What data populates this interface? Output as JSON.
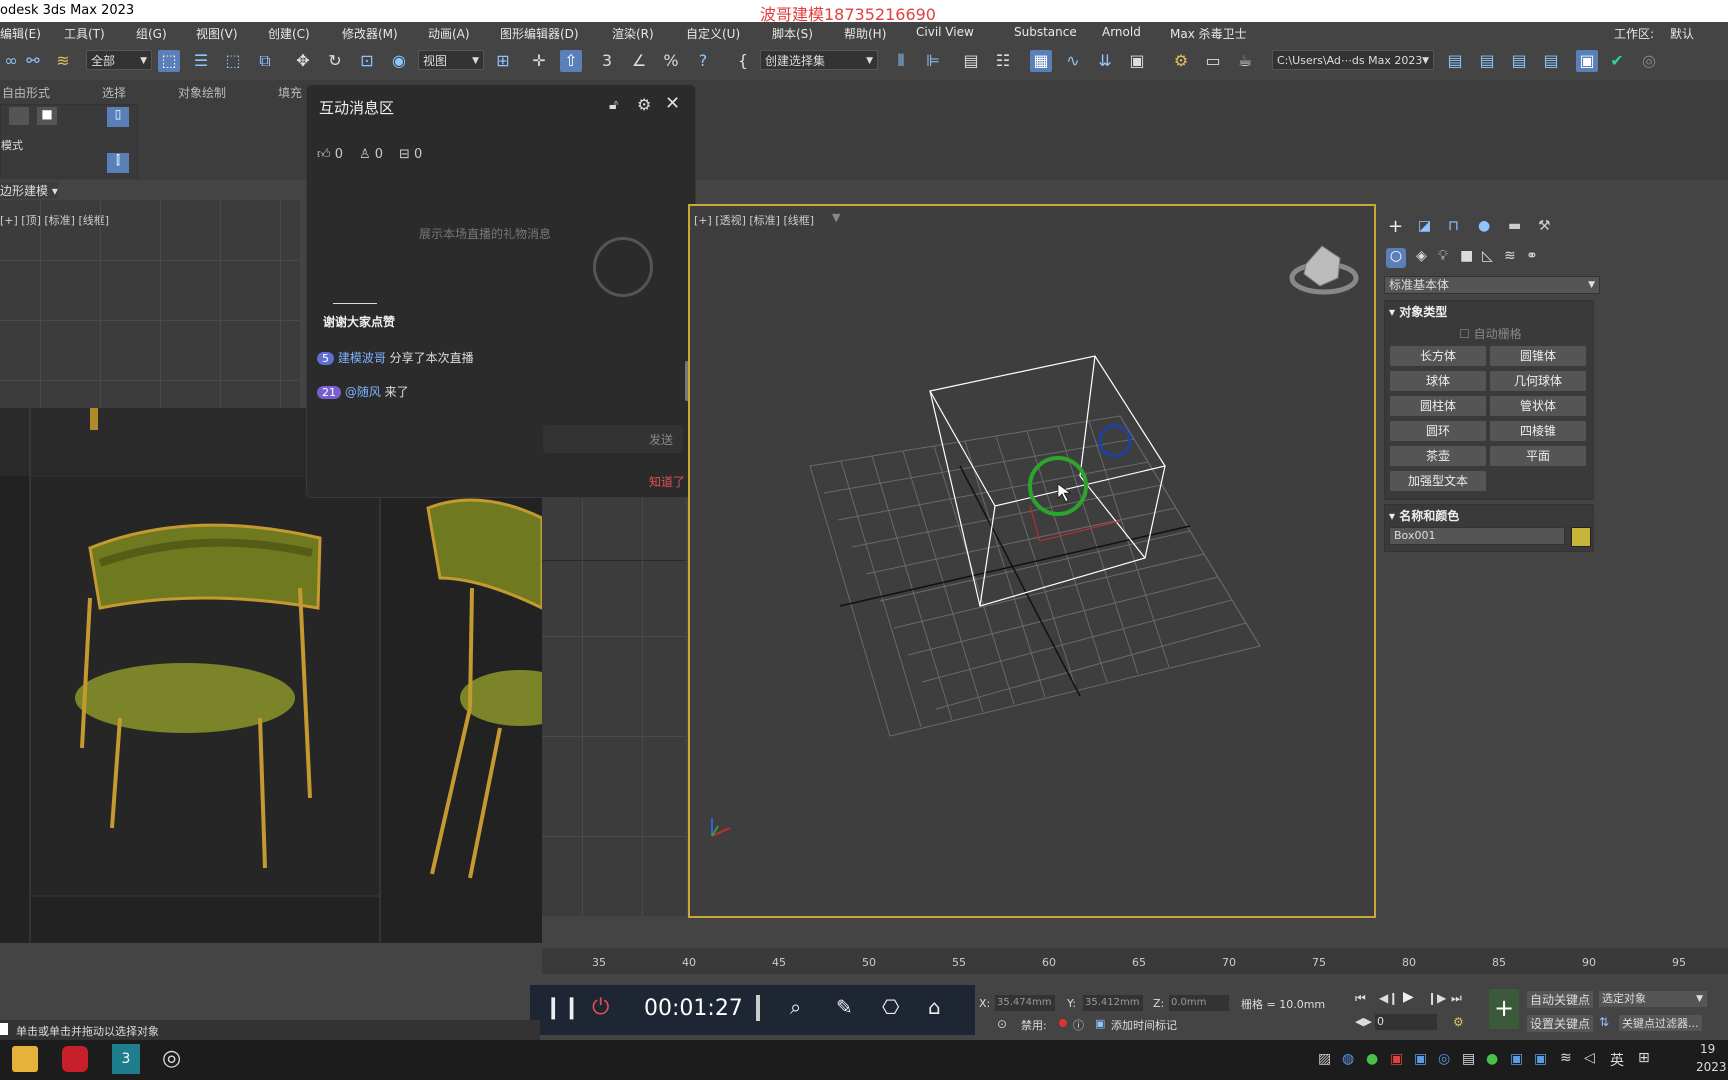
{
  "title_bar": {
    "title": "odesk 3ds Max 2023",
    "watermark": "波哥建模18735216690"
  },
  "menu": {
    "items": [
      "编辑(E)",
      "工具(T)",
      "组(G)",
      "视图(V)",
      "创建(C)",
      "修改器(M)",
      "动画(A)",
      "图形编辑器(D)",
      "渲染(R)",
      "自定义(U)",
      "脚本(S)",
      "帮助(H)",
      "Civil View",
      "Substance",
      "Arnold",
      "Max 杀毒卫士"
    ],
    "workspace_label": "工作区:",
    "workspace_value": "默认"
  },
  "toolbar": {
    "filter_combo": "全部",
    "view_combo": "视图",
    "selection_set_combo": "创建选择集",
    "path_combo": "C:\\Users\\Ad⋯ds Max 2023"
  },
  "ribbon": {
    "tabs": [
      "自由形式",
      "选择",
      "对象绘制",
      "填充"
    ],
    "mode_label": "模式",
    "section_label": "边形建模"
  },
  "left_viewport": {
    "label": "[+] [顶] [标准] [线框]"
  },
  "chat": {
    "title": "互动消息区",
    "likes": "0",
    "viewers": "0",
    "gifts": "0",
    "gift_placeholder": "展示本场直播的礼物消息",
    "thanks": "谢谢大家点赞",
    "messages": [
      {
        "level": "5",
        "user": "建模波哥",
        "text": "分享了本次直播"
      },
      {
        "level": "21",
        "user": "@随风",
        "text": "来了"
      }
    ],
    "send_label": "发送",
    "ack_label": "知道了"
  },
  "persp_viewport": {
    "label": "[+] [透视] [标准] [线框]"
  },
  "command_panel": {
    "category_combo": "标准基本体",
    "object_type_title": "对象类型",
    "autogrid_label": "自动栅格",
    "object_buttons": [
      "长方体",
      "圆锥体",
      "球体",
      "几何球体",
      "圆柱体",
      "管状体",
      "圆环",
      "四棱锥",
      "茶壶",
      "平面",
      "加强型文本"
    ],
    "name_color_title": "名称和颜色",
    "object_name": "Box001",
    "object_color": "#c8b43a"
  },
  "timeline": {
    "ticks": [
      "35",
      "40",
      "45",
      "50",
      "55",
      "60",
      "65",
      "70",
      "75",
      "80",
      "85",
      "90",
      "95"
    ]
  },
  "recorder": {
    "time": "00:01:27"
  },
  "status": {
    "x_label": "X:",
    "x_value": "35.474mm",
    "y_label": "Y:",
    "y_value": "35.412mm",
    "z_label": "Z:",
    "z_value": "0.0mm",
    "grid_text": "栅格 = 10.0mm",
    "disabled_label": "禁用:",
    "add_time_tag": "添加时间标记",
    "auto_key": "自动关键点",
    "set_key": "设置关键点",
    "selected_object_combo": "选定对象",
    "key_filters": "关键点过滤器...",
    "frame_value": "0",
    "prompt": "单击或单击并拖动以选择对象"
  },
  "taskbar": {
    "ime_label": "英",
    "time": "19",
    "date": "2023"
  }
}
